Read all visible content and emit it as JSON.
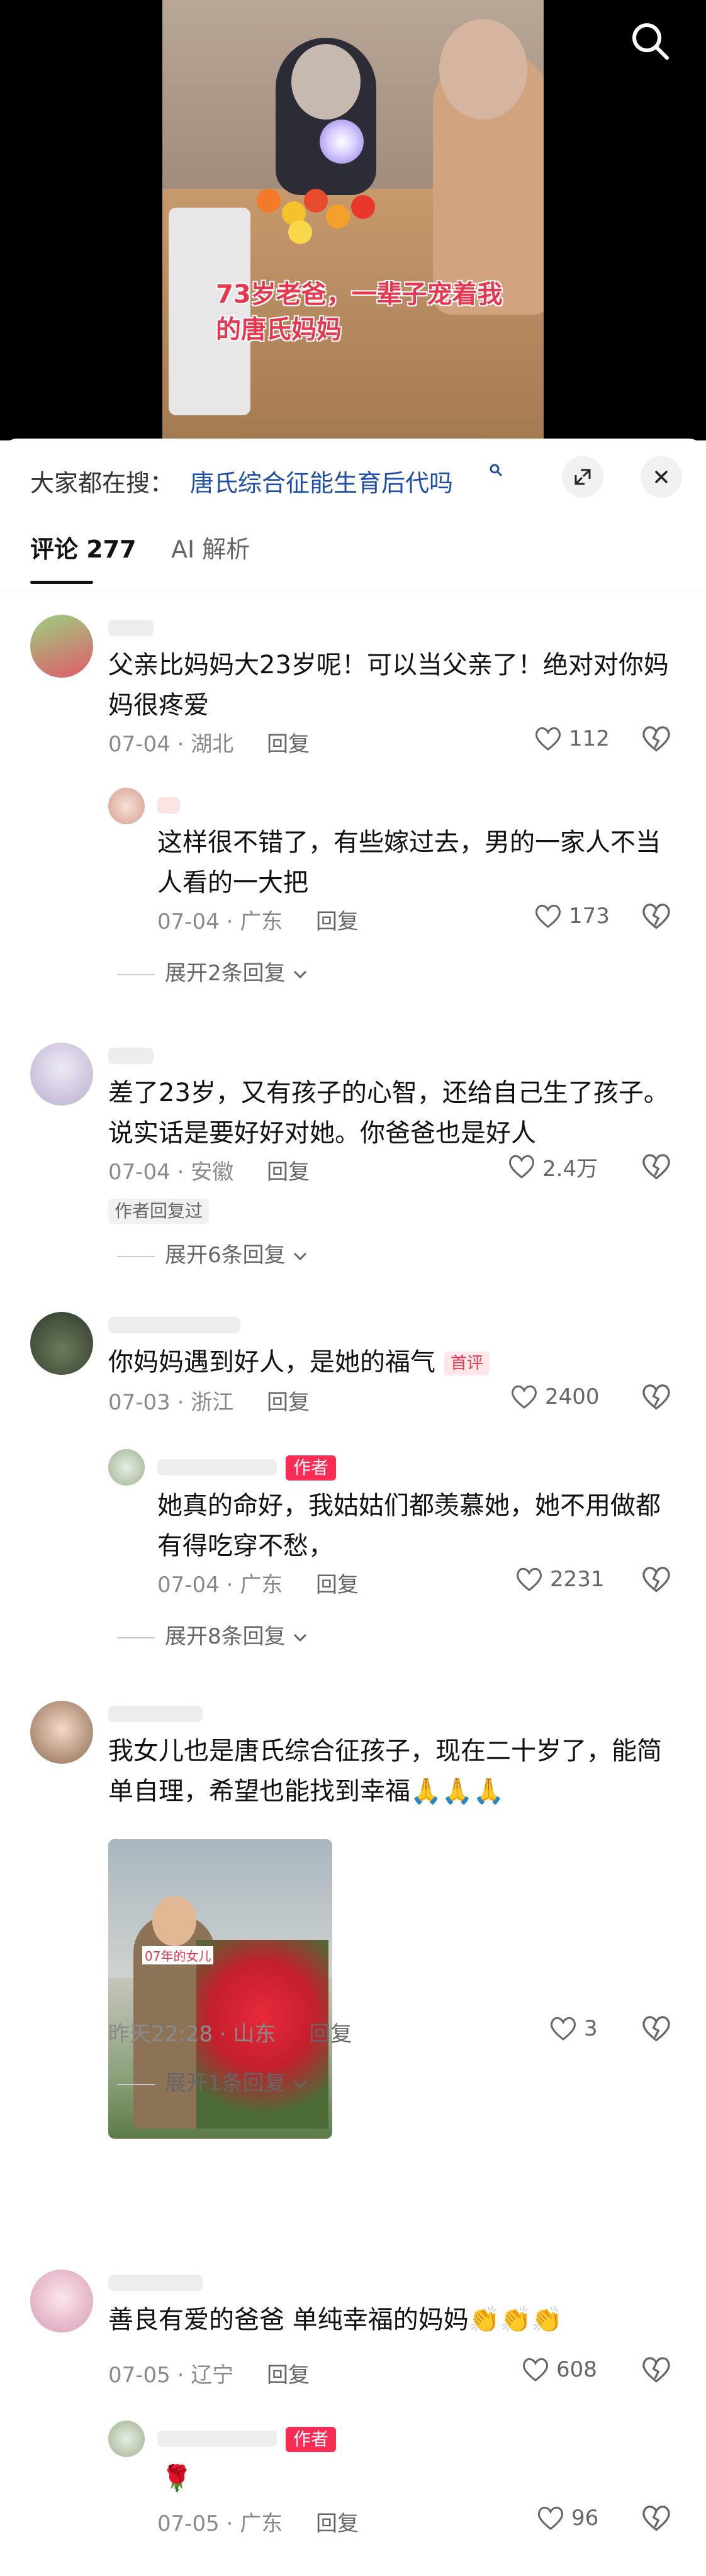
{
  "video": {
    "caption": "73岁老爸，一辈子宠着我的唐氏妈妈",
    "search_icon": "search-icon"
  },
  "search_bar": {
    "prefix": "大家都在搜：",
    "term": "唐氏综合征能生育后代吗",
    "term_icon": "search-small-icon",
    "expand_icon": "expand-icon",
    "close_icon": "close-icon"
  },
  "tabs": [
    {
      "label": "评论 277",
      "active": true
    },
    {
      "label": "AI 解析",
      "active": false
    }
  ],
  "comments": [
    {
      "text": "父亲比妈妈大23岁呢！可以当父亲了！绝对对你妈妈很疼爱",
      "date": "07-04",
      "location": "湖北",
      "reply": "回复",
      "likes": "112",
      "replies": [
        {
          "text": "这样很不错了，有些嫁过去，男的一家人不当人看的一大把",
          "date": "07-04",
          "location": "广东",
          "reply": "回复",
          "likes": "173"
        }
      ],
      "expand": "展开2条回复"
    },
    {
      "text": "差了23岁，又有孩子的心智，还给自己生了孩子。说实话是要好好对她。你爸爸也是好人",
      "date": "07-04",
      "location": "安徽",
      "reply": "回复",
      "likes": "2.4万",
      "tag": "作者回复过",
      "expand": "展开6条回复"
    },
    {
      "text": "你妈妈遇到好人，是她的福气",
      "badge": "首评",
      "date": "07-03",
      "location": "浙江",
      "reply": "回复",
      "likes": "2400",
      "replies": [
        {
          "author_badge": "作者",
          "text": "她真的命好，我姑姑们都羡慕她，她不用做都有得吃穿不愁，",
          "date": "07-04",
          "location": "广东",
          "reply": "回复",
          "likes": "2231"
        }
      ],
      "expand": "展开8条回复"
    },
    {
      "text": "我女儿也是唐氏综合征孩子，现在二十岁了，能简单自理，希望也能找到幸福🙏🙏🙏",
      "photo_label": "07年的女儿",
      "date": "昨天22:28",
      "location": "山东",
      "reply": "回复",
      "likes": "3",
      "expand": "展开1条回复"
    },
    {
      "text": "善良有爱的爸爸 单纯幸福的妈妈👏👏👏",
      "date": "07-05",
      "location": "辽宁",
      "reply": "回复",
      "likes": "608",
      "replies": [
        {
          "author_badge": "作者",
          "text": "🌹",
          "date": "07-05",
          "location": "广东",
          "reply": "回复",
          "likes": "96"
        }
      ]
    }
  ],
  "separator": "·",
  "colors": {
    "accent_red": "#fc2c55",
    "link_blue": "#1d4fa8",
    "meta_gray": "#8a8a8a"
  }
}
